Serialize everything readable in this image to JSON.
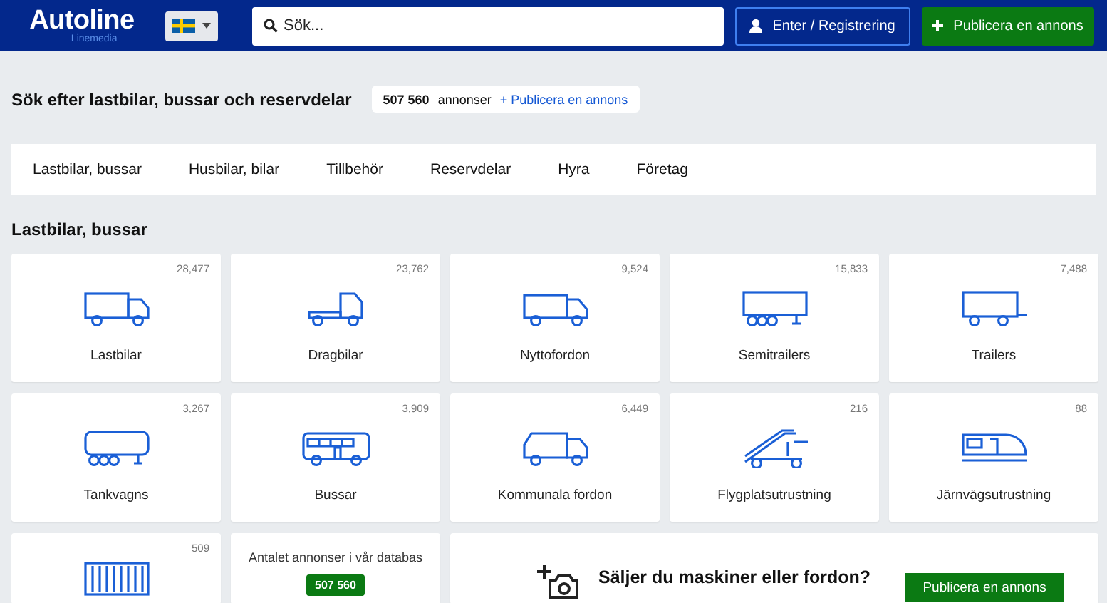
{
  "header": {
    "logo": "Autoline",
    "logo_sub": "Linemedia",
    "search": {
      "placeholder": "Sök..."
    },
    "login_button": "Enter / Registrering",
    "publish_button": "Publicera en annons"
  },
  "intro": {
    "title": "Sök efter lastbilar, bussar och reservdelar",
    "count": "507 560",
    "count_label": "annonser",
    "publish_link": "+ Publicera en annons"
  },
  "tabs": [
    "Lastbilar, bussar",
    "Husbilar, bilar",
    "Tillbehör",
    "Reservdelar",
    "Hyra",
    "Företag"
  ],
  "section_title": "Lastbilar, bussar",
  "categories": [
    {
      "label": "Lastbilar",
      "count": "28,477"
    },
    {
      "label": "Dragbilar",
      "count": "23,762"
    },
    {
      "label": "Nyttofordon",
      "count": "9,524"
    },
    {
      "label": "Semitrailers",
      "count": "15,833"
    },
    {
      "label": "Trailers",
      "count": "7,488"
    },
    {
      "label": "Tankvagns",
      "count": "3,267"
    },
    {
      "label": "Bussar",
      "count": "3,909"
    },
    {
      "label": "Kommunala fordon",
      "count": "6,449"
    },
    {
      "label": "Flygplatsutrustning",
      "count": "216"
    },
    {
      "label": "Järnvägsutrustning",
      "count": "88"
    },
    {
      "count": "509"
    }
  ],
  "stats": {
    "text": "Antalet annonser i vår databas",
    "count": "507 560"
  },
  "promo": {
    "question": "Säljer du maskiner eller fordon?",
    "button": "Publicera en annons"
  }
}
